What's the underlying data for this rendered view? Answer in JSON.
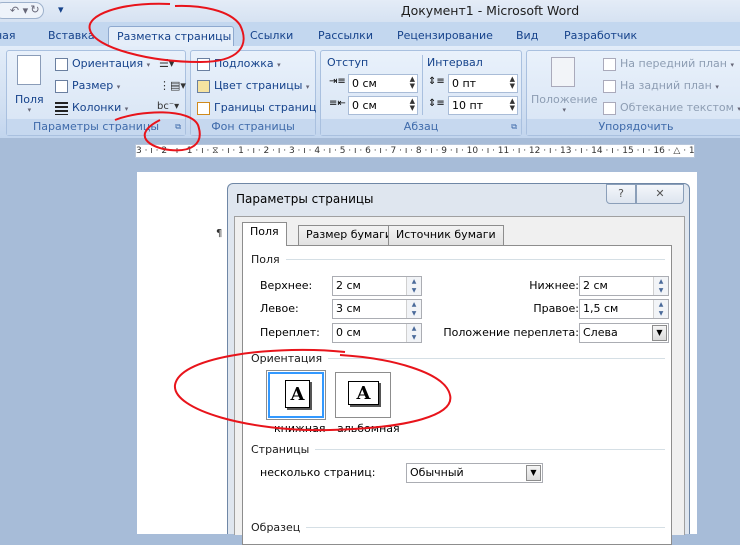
{
  "window": {
    "title": "Документ1 - Microsoft Word"
  },
  "qat": {
    "undo": "↶",
    "redo": "↻",
    "customize": "▾"
  },
  "tabs": [
    {
      "label": "Главная",
      "visible": "ная"
    },
    {
      "label": "Вставка"
    },
    {
      "label": "Разметка страницы",
      "active": true
    },
    {
      "label": "Ссылки"
    },
    {
      "label": "Рассылки"
    },
    {
      "label": "Рецензирование"
    },
    {
      "label": "Вид"
    },
    {
      "label": "Разработчик"
    }
  ],
  "ribbon": {
    "page_setup": {
      "label": "Параметры страницы",
      "margins": "Поля",
      "orientation": "Ориентация",
      "size": "Размер",
      "columns": "Колонки"
    },
    "page_background": {
      "label": "Фон страницы",
      "watermark": "Подложка",
      "page_color": "Цвет страницы",
      "page_borders": "Границы страниц"
    },
    "paragraph": {
      "label": "Абзац",
      "indent": "Отступ",
      "indent_left": "0 см",
      "indent_right": "0 см",
      "spacing": "Интервал",
      "spacing_before": "0 пт",
      "spacing_after": "10 пт"
    },
    "arrange": {
      "label": "Упорядочить",
      "position": "Положение",
      "bring_front": "На передний план",
      "send_back": "На задний план",
      "text_wrap": "Обтекание текстом"
    }
  },
  "ruler": {
    "ticks": "3 · ı · 2 · ı · 1 · ı · ⧖ · ı · 1 · ı · 2 · ı · 3 · ı · 4 · ı · 5 · ı · 6 · ı · 7 · ı · 8 · ı · 9 · ı · 10 · ı · 11 · ı · 12 · ı · 13 · ı · 14 · ı · 15 · ı · 16 · △ · 17 · ı · ı"
  },
  "document": {
    "pilcrow": "¶"
  },
  "dialog": {
    "title": "Параметры страницы",
    "help": "?",
    "close": "✕",
    "tabs": [
      "Поля",
      "Размер бумаги",
      "Источник бумаги"
    ],
    "margins_section": "Поля",
    "top_label": "Верхнее:",
    "top": "2 см",
    "bottom_label": "Нижнее:",
    "bottom": "2 см",
    "left_label": "Левое:",
    "left": "3 см",
    "right_label": "Правое:",
    "right": "1,5 см",
    "gutter_label": "Переплет:",
    "gutter": "0 см",
    "gutter_pos_label": "Положение переплета:",
    "gutter_pos": "Слева",
    "orientation_section": "Ориентация",
    "portrait": "книжная",
    "landscape": "альбомная",
    "orientation_selected": "portrait",
    "pages_section": "Страницы",
    "multiple_pages_label": "несколько страниц:",
    "multiple_pages": "Обычный",
    "preview_section": "Образец"
  },
  "colors": {
    "annotation": "#e8141b",
    "selection": "#3399ff",
    "tab_text": "#15428b"
  }
}
